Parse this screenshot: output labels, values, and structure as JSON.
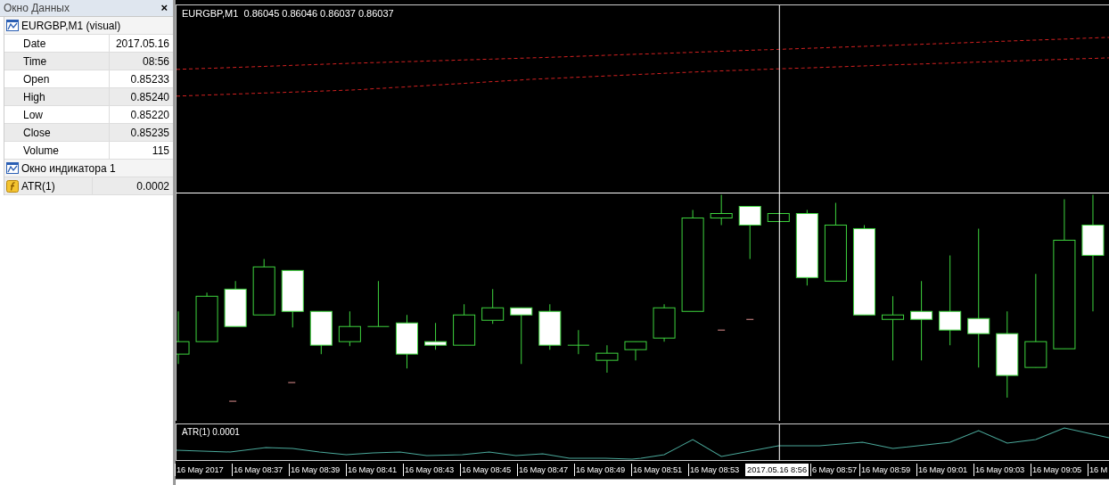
{
  "data_window": {
    "title": "Окно Данных",
    "close": "×",
    "sections": [
      {
        "title": "EURGBP,M1 (visual)",
        "rows": [
          {
            "kind": "field",
            "label": "Date",
            "value": "2017.05.16"
          },
          {
            "kind": "field",
            "label": "Time",
            "value": "08:56"
          },
          {
            "kind": "field",
            "label": "Open",
            "value": "0.85233"
          },
          {
            "kind": "field",
            "label": "High",
            "value": "0.85240"
          },
          {
            "kind": "field",
            "label": "Low",
            "value": "0.85220"
          },
          {
            "kind": "field",
            "label": "Close",
            "value": "0.85235"
          },
          {
            "kind": "field",
            "label": "Volume",
            "value": "115"
          }
        ]
      },
      {
        "title": "Окно индикатора 1",
        "rows": [
          {
            "kind": "indicator",
            "label": "ATR(1)",
            "value": "0.0002"
          }
        ]
      }
    ]
  },
  "chart": {
    "title": "EURGBP,M1  0.86045 0.86046 0.86037 0.86037",
    "indicator_label": "ATR(1) 0.0001",
    "time_axis": [
      "16 May 2017",
      "16 May 08:37",
      "16 May 08:39",
      "16 May 08:41",
      "16 May 08:43",
      "16 May 08:45",
      "16 May 08:47",
      "16 May 08:49",
      "16 May 08:51",
      "16 May 08:53",
      "6 May 08:57",
      "16 May 08:59",
      "16 May 09:01",
      "16 May 09:03",
      "16 May 09:05",
      "16 M"
    ],
    "cursor_time": "2017.05.16 8:56"
  }
}
